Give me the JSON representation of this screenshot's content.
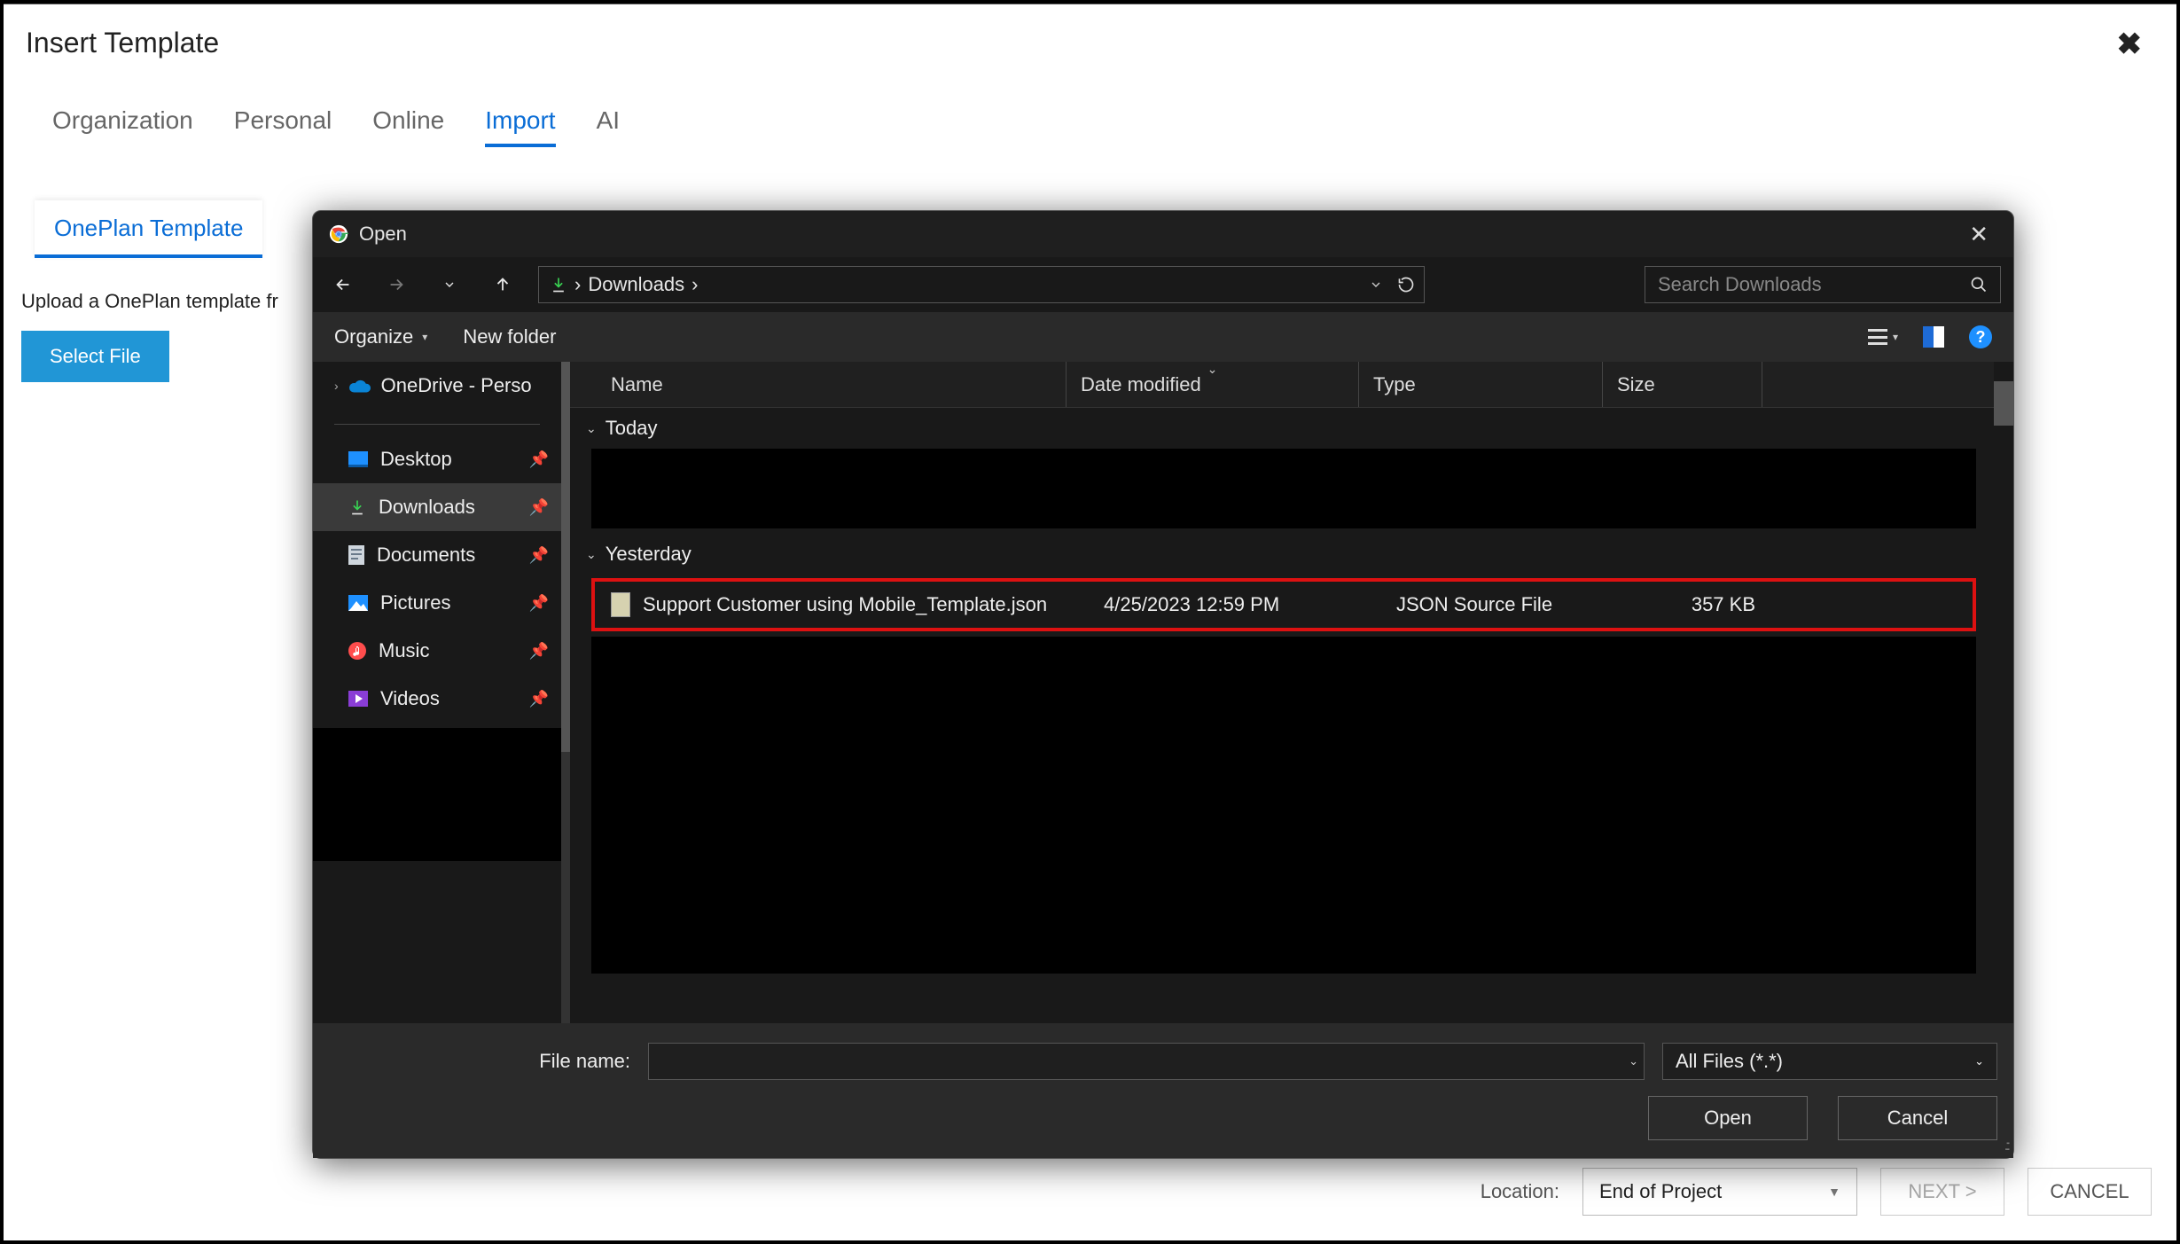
{
  "insertTemplate": {
    "title": "Insert Template",
    "closeGlyph": "✖",
    "tabs": {
      "organization": "Organization",
      "personal": "Personal",
      "online": "Online",
      "import": "Import",
      "ai": "AI"
    },
    "subTab": "OnePlan Template",
    "uploadText": "Upload a OnePlan template fr",
    "selectFileButton": "Select File",
    "footer": {
      "locationLabel": "Location:",
      "locationValue": "End of Project",
      "nextButton": "NEXT >",
      "cancelButton": "CANCEL"
    }
  },
  "openDialog": {
    "title": "Open",
    "closeGlyph": "✕",
    "path": {
      "folder": "Downloads",
      "sep": "›"
    },
    "searchPlaceholder": "Search Downloads",
    "toolbar": {
      "organize": "Organize",
      "newFolder": "New folder"
    },
    "sidebar": {
      "onedrive": "OneDrive - Perso",
      "items": {
        "desktop": "Desktop",
        "downloads": "Downloads",
        "documents": "Documents",
        "pictures": "Pictures",
        "music": "Music",
        "videos": "Videos"
      }
    },
    "columns": {
      "name": "Name",
      "date": "Date modified",
      "type": "Type",
      "size": "Size"
    },
    "groups": {
      "today": "Today",
      "yesterday": "Yesterday"
    },
    "file": {
      "name": "Support Customer using Mobile_Template.json",
      "date": "4/25/2023 12:59 PM",
      "type": "JSON Source File",
      "size": "357 KB"
    },
    "fileNameLabel": "File name:",
    "fileNameValue": "",
    "typeFilter": "All Files (*.*)",
    "openButton": "Open",
    "cancelButton": "Cancel"
  }
}
